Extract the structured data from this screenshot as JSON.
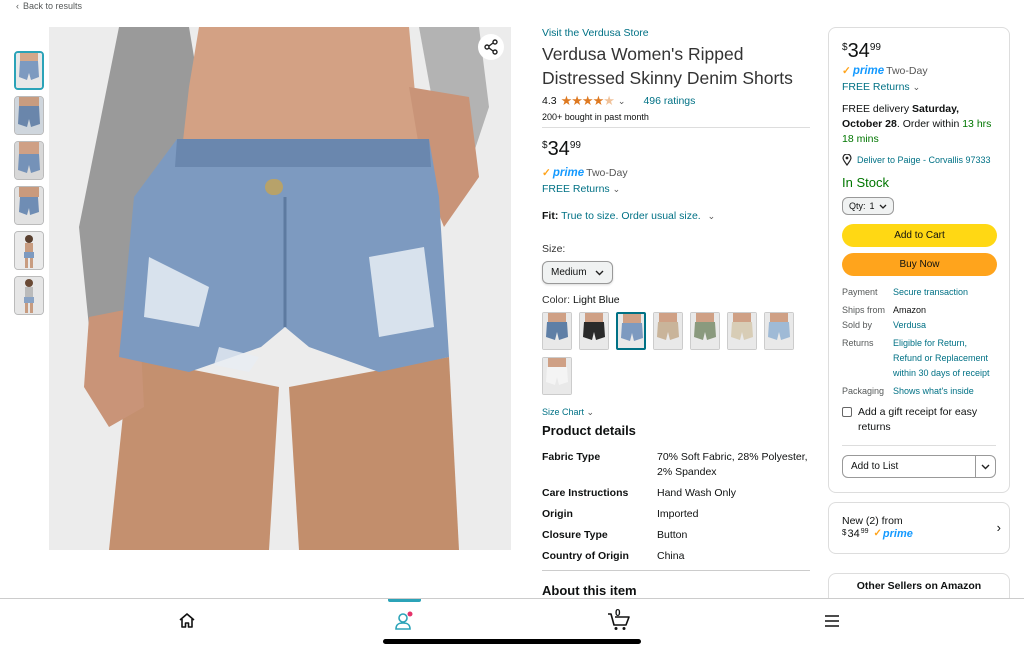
{
  "nav": {
    "back_label": "Back to results"
  },
  "product": {
    "store_link": "Visit the Verdusa Store",
    "title": "Verdusa Women's Ripped Distressed Skinny Denim Shorts",
    "rating": "4.3",
    "ratings_count": "496 ratings",
    "bought": "200+ bought in past month",
    "price": {
      "symbol": "$",
      "whole": "34",
      "cents": "99"
    },
    "prime_brand": "prime",
    "prime_label": "Two-Day",
    "returns": "FREE Returns",
    "fit_label": "Fit:",
    "fit_value": "True to size. Order usual size.",
    "size_label": "Size:",
    "size_selected": "Medium",
    "color_label": "Color:",
    "color_value": "Light Blue",
    "swatch_colors": [
      "#5f7fa6",
      "#2a2a2a",
      "#7d9ac0",
      "#c9b49a",
      "#8a9a7e",
      "#d8cdb6",
      "#9fbad6",
      "#f4f4f4"
    ],
    "size_chart": "Size Chart",
    "details_title": "Product details",
    "details": [
      {
        "key": "Fabric Type",
        "value": "70% Soft Fabric, 28% Polyester, 2% Spandex"
      },
      {
        "key": "Care Instructions",
        "value": "Hand Wash Only"
      },
      {
        "key": "Origin",
        "value": "Imported"
      },
      {
        "key": "Closure Type",
        "value": "Button"
      },
      {
        "key": "Country of Origin",
        "value": "China"
      }
    ],
    "about_title": "About this item"
  },
  "buybox": {
    "price": {
      "symbol": "$",
      "whole": "34",
      "cents": "99"
    },
    "prime_brand": "prime",
    "prime_label": "Two-Day",
    "returns": "FREE Returns",
    "delivery_prefix": "FREE delivery",
    "delivery_date": "Saturday, October 28",
    "delivery_mid": ". Order within",
    "delivery_time": "13 hrs 18 mins",
    "deliver_to": "Deliver to Paige - Corvallis 97333",
    "stock": "In Stock",
    "qty_label": "Qty:",
    "qty_value": "1",
    "add_to_cart": "Add to Cart",
    "buy_now": "Buy Now",
    "meta": [
      {
        "key": "Payment",
        "value": "Secure transaction",
        "link": true
      },
      {
        "key": "Ships from",
        "value": "Amazon",
        "link": false
      },
      {
        "key": "Sold by",
        "value": "Verdusa",
        "link": true
      },
      {
        "key": "Returns",
        "value": "Eligible for Return, Refund or Replacement within 30 days of receipt",
        "link": true
      },
      {
        "key": "Packaging",
        "value": "Shows what's inside",
        "link": true
      }
    ],
    "gift": "Add a gift receipt for easy returns",
    "add_to_list": "Add to List"
  },
  "new_offers": {
    "text": "New (2) from",
    "price_symbol": "$",
    "price_whole": "34",
    "price_cents": "99",
    "prime_brand": "prime"
  },
  "other_sellers": "Other Sellers on Amazon",
  "bottom_nav": {
    "cart_count": "0"
  },
  "colors": {
    "accent": "#2ba3b8",
    "link": "#007185",
    "star": "#de7921",
    "cart": "#ffd814",
    "buy": "#ffa41c",
    "instock": "#007600",
    "prime": "#1399ff"
  }
}
